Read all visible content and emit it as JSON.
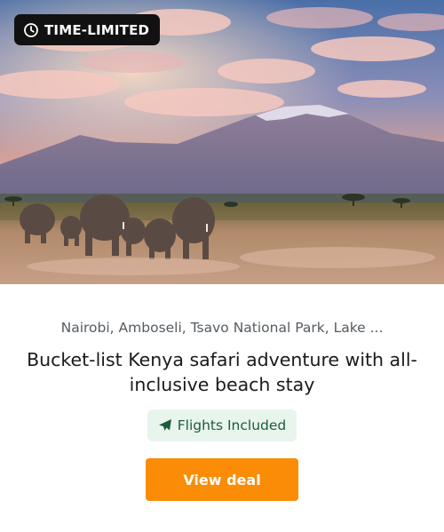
{
  "badge": {
    "label": "TIME-LIMITED",
    "icon": "clock-icon"
  },
  "hero": {
    "image": "kilimanjaro-elephants-photo"
  },
  "deal": {
    "location": "Nairobi, Amboseli, Tsavo National Park, Lake ...",
    "title": "Bucket-list Kenya safari adventure with all-inclusive beach stay",
    "feature": {
      "label": "Flights Included",
      "icon": "plane-icon"
    },
    "cta_label": "View deal"
  },
  "colors": {
    "cta": "#fb8c05",
    "badge_bg": "#111111",
    "feature_bg": "#e8f5ec",
    "feature_text": "#1d5b3a"
  }
}
